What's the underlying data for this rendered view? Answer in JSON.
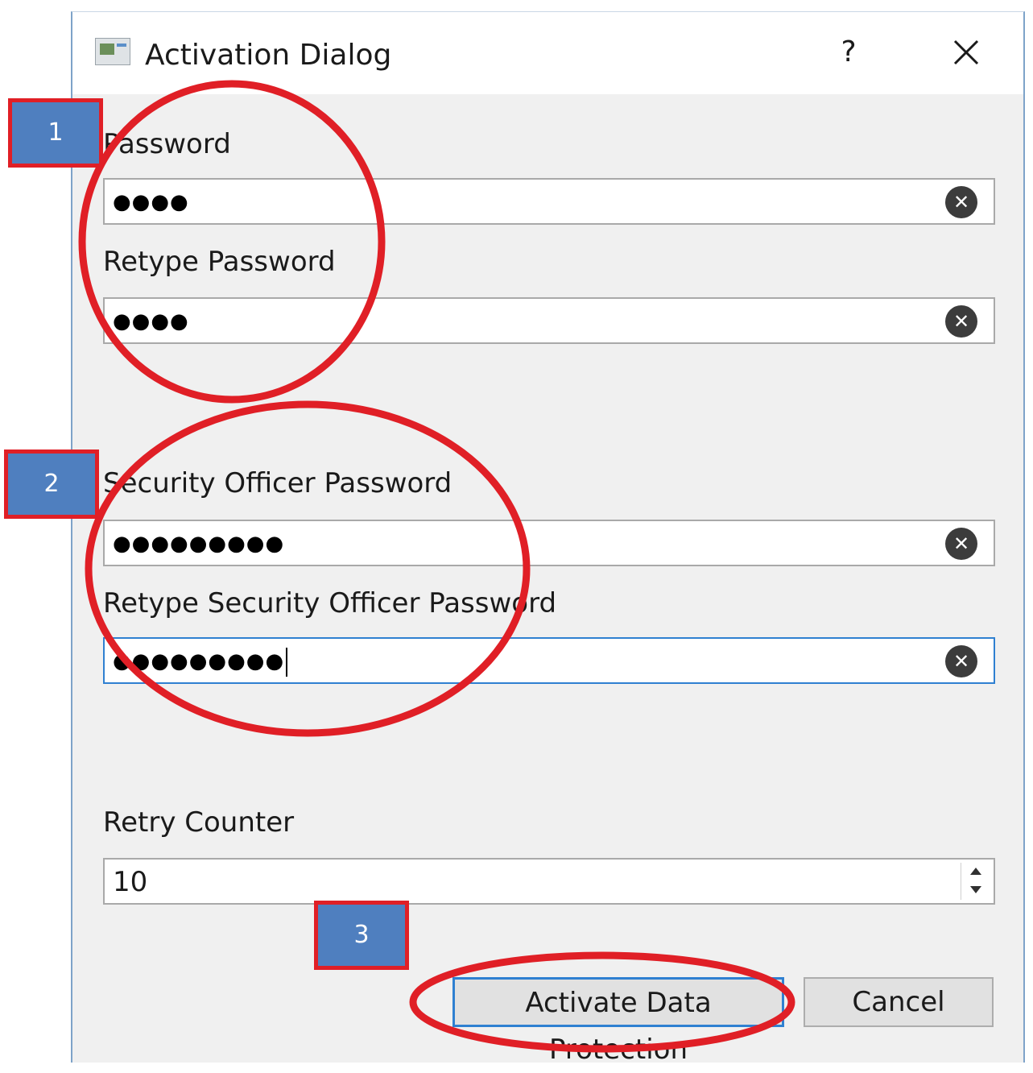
{
  "dialog": {
    "title": "Activation Dialog",
    "help_label": "?"
  },
  "fields": {
    "password": {
      "label": "Password",
      "mask": "●●●●"
    },
    "retype_password": {
      "label": "Retype Password",
      "mask": "●●●●"
    },
    "security_officer_password": {
      "label": "Security Officer Password",
      "mask": "●●●●●●●●●"
    },
    "retype_security_officer_password": {
      "label": "Retype Security Officer Password",
      "mask": "●●●●●●●●●"
    },
    "clear_glyph": "✕"
  },
  "retry_counter": {
    "label": "Retry Counter",
    "value": "10"
  },
  "buttons": {
    "activate": "Activate Data Protection",
    "cancel": "Cancel"
  },
  "annotations": {
    "markers": [
      "1",
      "2",
      "3"
    ],
    "color": "#e01f26",
    "marker_fill": "#4f7fbf"
  }
}
